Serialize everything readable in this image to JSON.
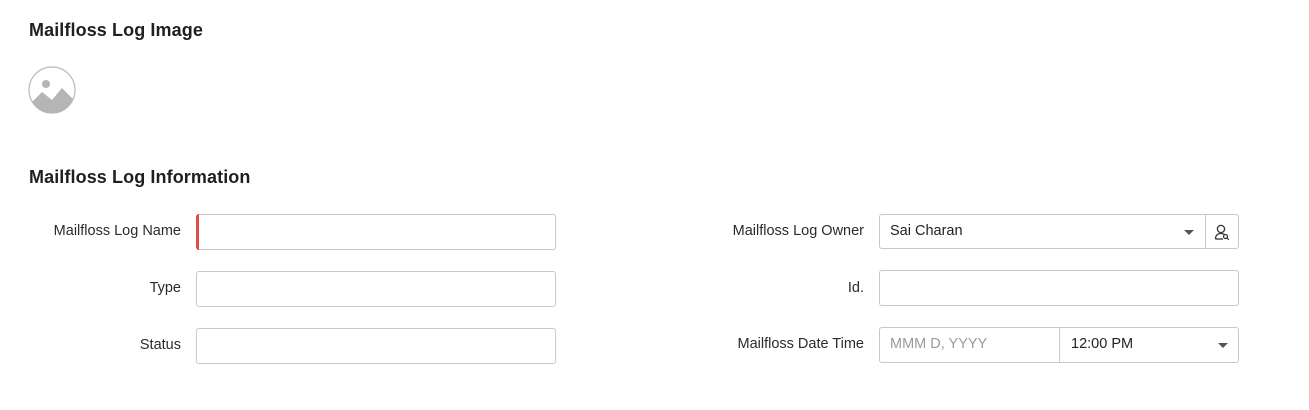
{
  "sections": {
    "image_title": "Mailfloss Log Image",
    "info_title": "Mailfloss Log Information"
  },
  "fields": {
    "name_label": "Mailfloss Log Name",
    "type_label": "Type",
    "status_label": "Status",
    "owner_label": "Mailfloss Log Owner",
    "owner_value": "Sai Charan",
    "id_label": "Id.",
    "datetime_label": "Mailfloss Date Time",
    "date_placeholder": "MMM D, YYYY",
    "time_value": "12:00 PM"
  },
  "colors": {
    "mandatory_marker": "#e04b4b",
    "border": "#c8c8c8"
  },
  "icons": {
    "image_placeholder": "image-placeholder-icon",
    "owner_lookup": "user-lookup-icon",
    "dropdown": "chevron-down-icon"
  }
}
